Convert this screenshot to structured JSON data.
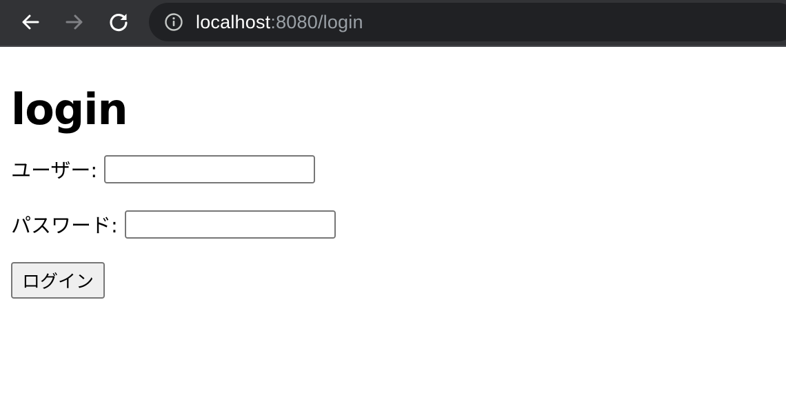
{
  "browser": {
    "url_host": "localhost",
    "url_rest": ":8080/login",
    "icons": {
      "back": "arrow-left-icon",
      "forward": "arrow-right-icon",
      "reload": "reload-icon",
      "site_info": "info-icon"
    },
    "colors": {
      "toolbar": "#323336",
      "omnibox": "#202124",
      "url_host": "#ffffff",
      "url_rest": "#9aa0a6"
    }
  },
  "page": {
    "title": "login",
    "form": {
      "user_label": "ユーザー:",
      "user_value": "",
      "password_label": "パスワード:",
      "password_value": "",
      "submit_label": "ログイン"
    }
  }
}
